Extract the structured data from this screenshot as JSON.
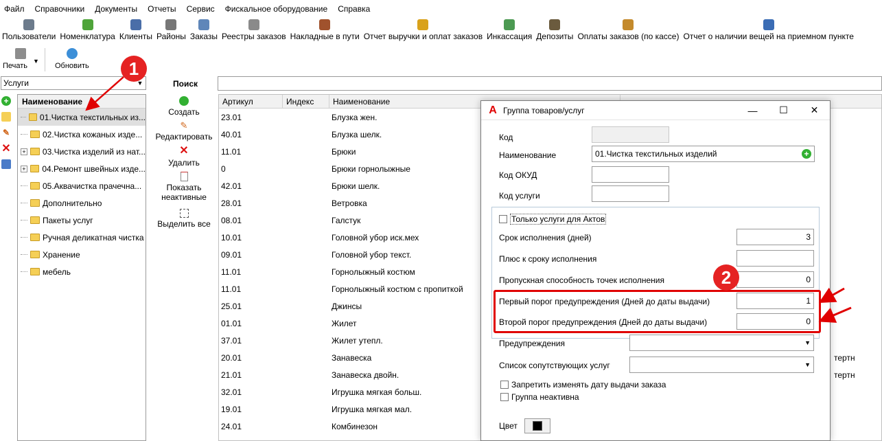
{
  "menu": [
    "Файл",
    "Справочники",
    "Документы",
    "Отчеты",
    "Сервис",
    "Фискальное оборудование",
    "Справка"
  ],
  "toolbar": [
    {
      "label": "Пользователи",
      "icon": "users-icon",
      "color": "#6c7b8c"
    },
    {
      "label": "Номенклатура",
      "icon": "nomenclature-icon",
      "color": "#4fa43a"
    },
    {
      "label": "Клиенты",
      "icon": "clients-icon",
      "color": "#4a6ea8"
    },
    {
      "label": "Районы",
      "icon": "districts-icon",
      "color": "#777777"
    },
    {
      "label": "Заказы",
      "icon": "orders-icon",
      "color": "#5f86b9"
    },
    {
      "label": "Реестры заказов",
      "icon": "order-registers-icon",
      "color": "#8a8a8a"
    },
    {
      "label": "Накладные в пути",
      "icon": "invoices-transit-icon",
      "color": "#a0522d"
    },
    {
      "label": "Отчет выручки и оплат заказов",
      "icon": "revenue-report-icon",
      "color": "#d9a21b"
    },
    {
      "label": "Инкассация",
      "icon": "collection-icon",
      "color": "#4c9a52"
    },
    {
      "label": "Депозиты",
      "icon": "deposits-icon",
      "color": "#6b5b3e"
    },
    {
      "label": "Оплаты заказов (по кассе)",
      "icon": "order-payments-icon",
      "color": "#c48a2c"
    },
    {
      "label": "Отчет о наличии вещей на приемном пункте",
      "icon": "items-report-icon",
      "color": "#3b6db5"
    }
  ],
  "toolbar2": {
    "print": "Печать",
    "refresh": "Обновить"
  },
  "category_select": "Услуги",
  "tree": {
    "header": "Наименование",
    "items": [
      {
        "label": "01.Чистка текстильных из...",
        "expandable": false,
        "selected": true
      },
      {
        "label": "02.Чистка кожаных изде...",
        "expandable": false,
        "selected": false
      },
      {
        "label": "03.Чистка изделий из нат...",
        "expandable": true,
        "selected": false
      },
      {
        "label": "04.Ремонт швейных изде...",
        "expandable": true,
        "selected": false
      },
      {
        "label": "05.Аквачистка прачечна...",
        "expandable": false,
        "selected": false
      },
      {
        "label": "Дополнительно",
        "expandable": false,
        "selected": false
      },
      {
        "label": "Пакеты услуг",
        "expandable": false,
        "selected": false
      },
      {
        "label": "Ручная деликатная чистка",
        "expandable": false,
        "selected": false
      },
      {
        "label": "Хранение",
        "expandable": false,
        "selected": false
      },
      {
        "label": "мебель",
        "expandable": false,
        "selected": false
      }
    ]
  },
  "actions": {
    "title": "Поиск",
    "create": "Создать",
    "edit": "Редактировать",
    "delete": "Удалить",
    "show_inactive": "Показать неактивные",
    "select_all": "Выделить все"
  },
  "grid": {
    "headers": [
      "Артикул",
      "Индекс",
      "Наименование"
    ],
    "rows": [
      {
        "art": "23.01",
        "name": "Блузка жен.",
        "extra": ""
      },
      {
        "art": "40.01",
        "name": "Блузка шелк.",
        "extra": ""
      },
      {
        "art": "11.01",
        "name": "Брюки",
        "extra": ""
      },
      {
        "art": "0",
        "name": "Брюки горнолыжные",
        "extra": ""
      },
      {
        "art": "42.01",
        "name": "Брюки шелк.",
        "extra": ""
      },
      {
        "art": "28.01",
        "name": "Ветровка",
        "extra": ""
      },
      {
        "art": "08.01",
        "name": "Галстук",
        "extra": ""
      },
      {
        "art": "10.01",
        "name": "Головной убор иск.мех",
        "extra": ""
      },
      {
        "art": "09.01",
        "name": "Головной убор текст.",
        "extra": ""
      },
      {
        "art": "11.01",
        "name": "Горнолыжный костюм",
        "extra": ""
      },
      {
        "art": "11.01",
        "name": "Горнолыжный костюм с пропиткой",
        "extra": ""
      },
      {
        "art": "25.01",
        "name": "Джинсы",
        "extra": ""
      },
      {
        "art": "01.01",
        "name": "Жилет",
        "extra": ""
      },
      {
        "art": "37.01",
        "name": "Жилет утепл.",
        "extra": ""
      },
      {
        "art": "20.01",
        "name": "Занавеска",
        "extra": "тертн"
      },
      {
        "art": "21.01",
        "name": "Занавеска двойн.",
        "extra": "тертн"
      },
      {
        "art": "32.01",
        "name": "Игрушка мягкая больш.",
        "extra": ""
      },
      {
        "art": "19.01",
        "name": "Игрушка мягкая мал.",
        "extra": ""
      },
      {
        "art": "24.01",
        "name": "Комбинезон",
        "extra": ""
      }
    ]
  },
  "dialog": {
    "title": "Группа товаров/услуг",
    "code_label": "Код",
    "code_value": "",
    "name_label": "Наименование",
    "name_value": "01.Чистка текстильных изделий",
    "okud_label": "Код ОКУД",
    "okud_value": "",
    "service_code_label": "Код услуги",
    "service_code_value": "",
    "only_acts_label": "Только услуги для Актов",
    "term_label": "Срок исполнения (дней)",
    "term_value": "3",
    "plus_term_label": "Плюс к сроку исполнения",
    "plus_term_value": "",
    "capacity_label": "Пропускная способность точек исполнения",
    "capacity_value": "0",
    "first_threshold_label": "Первый порог предупреждения (Дней до даты выдачи)",
    "first_threshold_value": "1",
    "second_threshold_label": "Второй порог предупреждения (Дней до даты выдачи)",
    "second_threshold_value": "0",
    "warnings_label": "Предупреждения",
    "related_label": "Список сопутствующих услуг",
    "forbid_date_label": "Запретить изменять дату выдачи заказа",
    "inactive_label": "Группа неактивна",
    "color_label": "Цвет",
    "color_value": "#000000"
  },
  "annotations": {
    "badge1": "1",
    "badge2": "2",
    "accent": "#e52222"
  }
}
